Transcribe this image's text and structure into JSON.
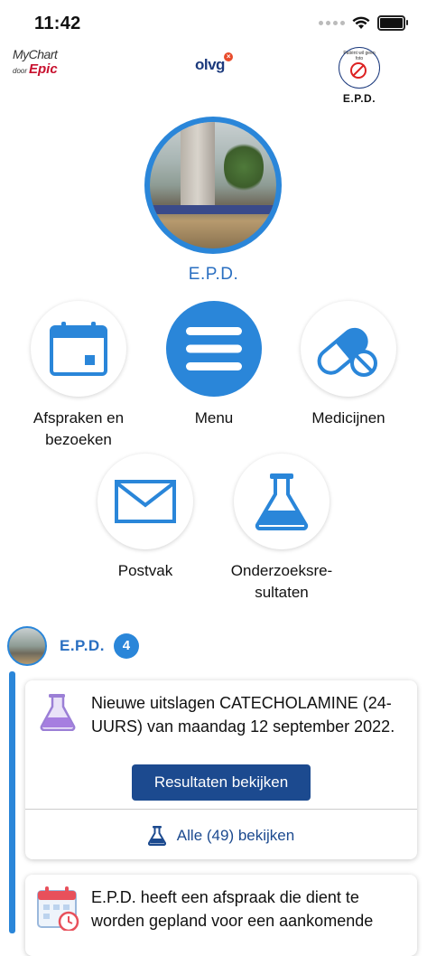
{
  "status_bar": {
    "time": "11:42"
  },
  "header": {
    "mychart_logo": "MyChart",
    "mychart_sub": "door",
    "epic_logo": "Epic",
    "olvg_logo": "olvg",
    "badge_small_text": "Patiënt wil geen foto",
    "badge_label": "E.P.D."
  },
  "profile": {
    "name": "E.P.D."
  },
  "menu": {
    "appointments": "Afspraken en bezoeken",
    "menu": "Menu",
    "medications": "Medicijnen",
    "inbox": "Postvak",
    "results": "Onderzoeksre-sultaten"
  },
  "feed": {
    "name": "E.P.D.",
    "count": "4",
    "card1": {
      "message": "Nieuwe uitslagen CATECHOLAMINE (24-UURS) van maandag 12 september 2022.",
      "primary_button": "Resultaten bekijken",
      "all_link": "Alle (49) bekijken"
    },
    "card2": {
      "message": "E.P.D. heeft een afspraak die dient te worden gepland voor een aankomende"
    }
  },
  "colors": {
    "accent": "#2a86d9",
    "dark_button": "#1c4a8f",
    "epic_red": "#c8102e"
  }
}
